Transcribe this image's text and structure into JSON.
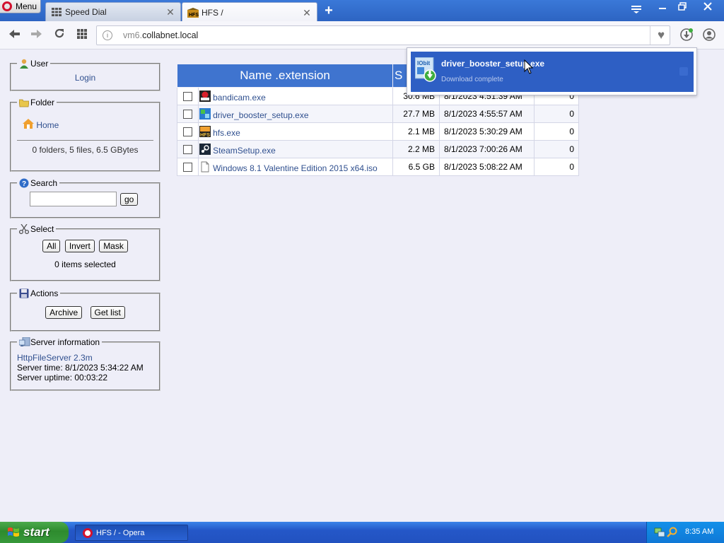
{
  "browser": {
    "menu_label": "Menu",
    "tabs": [
      {
        "title": "Speed Dial",
        "icon": "speed-dial-icon"
      },
      {
        "title": "HFS /",
        "icon": "hfs-icon"
      }
    ],
    "new_tab": "+",
    "address": {
      "host_dim": "vm6.",
      "host": "collabnet.local"
    }
  },
  "sidebar": {
    "user": {
      "legend": "User",
      "login": "Login"
    },
    "folder": {
      "legend": "Folder",
      "home": "Home",
      "summary": "0 folders, 5 files, 6.5 GBytes"
    },
    "search": {
      "legend": "Search",
      "value": "",
      "go": "go"
    },
    "select": {
      "legend": "Select",
      "all": "All",
      "invert": "Invert",
      "mask": "Mask",
      "status": "0 items selected"
    },
    "actions": {
      "legend": "Actions",
      "archive": "Archive",
      "get_list": "Get list"
    },
    "server": {
      "legend": "Server information",
      "version_link": "HttpFileServer 2.3m",
      "time": "Server time: 8/1/2023 5:34:22 AM",
      "uptime": "Server uptime: 00:03:22"
    }
  },
  "files": {
    "header_name": "Name .extension",
    "header_size": "S",
    "rows": [
      {
        "name": "bandicam.exe",
        "size": "30.6 MB",
        "date": "8/1/2023 4:51:39 AM",
        "hits": "0",
        "icon": "bandicam-icon"
      },
      {
        "name": "driver_booster_setup.exe",
        "size": "27.7 MB",
        "date": "8/1/2023 4:55:57 AM",
        "hits": "0",
        "icon": "driver-booster-icon"
      },
      {
        "name": "hfs.exe",
        "size": "2.1 MB",
        "date": "8/1/2023 5:30:29 AM",
        "hits": "0",
        "icon": "hfs-icon"
      },
      {
        "name": "SteamSetup.exe",
        "size": "2.2 MB",
        "date": "8/1/2023 7:00:26 AM",
        "hits": "0",
        "icon": "steam-icon"
      },
      {
        "name": "Windows 8.1 Valentine Edition 2015 x64.iso",
        "size": "6.5 GB",
        "date": "8/1/2023 5:08:22 AM",
        "hits": "0",
        "icon": "file-icon"
      }
    ]
  },
  "download_popup": {
    "filename": "driver_booster_setup.exe",
    "status": "Download complete",
    "icon_label": "IObit"
  },
  "taskbar": {
    "start": "start",
    "task": "HFS / - Opera",
    "clock": "8:35 AM"
  },
  "colors": {
    "tab_bar": "#2d64c2",
    "table_header": "#3f74cf",
    "popup_item": "#2e5fc4",
    "link": "#30508f",
    "taskbar": "#2457c8",
    "start": "#37993a"
  }
}
